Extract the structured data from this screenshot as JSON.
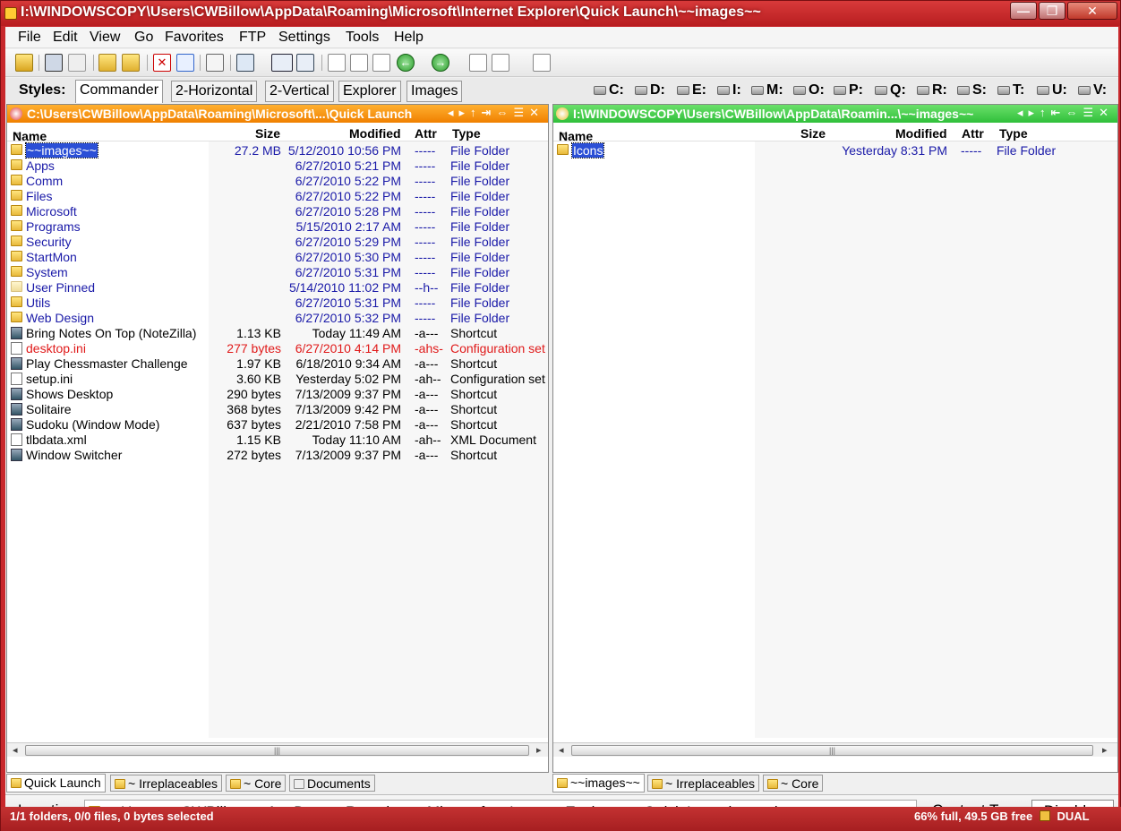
{
  "window": {
    "title": "I:\\WINDOWSCOPY\\Users\\CWBillow\\AppData\\Roaming\\Microsoft\\Internet Explorer\\Quick Launch\\~~images~~",
    "minimize": "—",
    "maximize": "❐",
    "close": "✕"
  },
  "menu": [
    "File",
    "Edit",
    "View",
    "Go",
    "Favorites",
    "FTP",
    "Settings",
    "Tools",
    "Help"
  ],
  "styles": {
    "label": "Styles:",
    "tabs": [
      "Commander",
      "2-Horizontal",
      "2-Vertical",
      "Explorer",
      "Images"
    ]
  },
  "drives": [
    "C:",
    "D:",
    "E:",
    "I:",
    "M:",
    "O:",
    "P:",
    "Q:",
    "R:",
    "S:",
    "T:",
    "U:",
    "V:"
  ],
  "left_pane": {
    "path": "C:\\Users\\CWBillow\\AppData\\Roaming\\Microsoft\\...\\Quick Launch",
    "columns": {
      "name": "Name",
      "size": "Size",
      "modified": "Modified",
      "attr": "Attr",
      "type": "Type"
    },
    "rows": [
      {
        "name": "~~images~~",
        "size": "27.2 MB",
        "modified": "5/12/2010 10:56 PM",
        "attr": "-----",
        "type": "File Folder",
        "kind": "folder",
        "color": "blue",
        "selected": true
      },
      {
        "name": "Apps",
        "size": "",
        "modified": "6/27/2010 5:21 PM",
        "attr": "-----",
        "type": "File Folder",
        "kind": "folder",
        "color": "blue"
      },
      {
        "name": "Comm",
        "size": "",
        "modified": "6/27/2010 5:22 PM",
        "attr": "-----",
        "type": "File Folder",
        "kind": "folder",
        "color": "blue"
      },
      {
        "name": "Files",
        "size": "",
        "modified": "6/27/2010 5:22 PM",
        "attr": "-----",
        "type": "File Folder",
        "kind": "folder",
        "color": "blue"
      },
      {
        "name": "Microsoft",
        "size": "",
        "modified": "6/27/2010 5:28 PM",
        "attr": "-----",
        "type": "File Folder",
        "kind": "folder",
        "color": "blue"
      },
      {
        "name": "Programs",
        "size": "",
        "modified": "5/15/2010 2:17 AM",
        "attr": "-----",
        "type": "File Folder",
        "kind": "folder",
        "color": "blue"
      },
      {
        "name": "Security",
        "size": "",
        "modified": "6/27/2010 5:29 PM",
        "attr": "-----",
        "type": "File Folder",
        "kind": "folder",
        "color": "blue"
      },
      {
        "name": "StartMon",
        "size": "",
        "modified": "6/27/2010 5:30 PM",
        "attr": "-----",
        "type": "File Folder",
        "kind": "folder",
        "color": "blue"
      },
      {
        "name": "System",
        "size": "",
        "modified": "6/27/2010 5:31 PM",
        "attr": "-----",
        "type": "File Folder",
        "kind": "folder",
        "color": "blue"
      },
      {
        "name": "User Pinned",
        "size": "",
        "modified": "5/14/2010 11:02 PM",
        "attr": "--h--",
        "type": "File Folder",
        "kind": "folder-pale",
        "color": "blue"
      },
      {
        "name": "Utils",
        "size": "",
        "modified": "6/27/2010 5:31 PM",
        "attr": "-----",
        "type": "File Folder",
        "kind": "folder",
        "color": "blue"
      },
      {
        "name": "Web Design",
        "size": "",
        "modified": "6/27/2010 5:32 PM",
        "attr": "-----",
        "type": "File Folder",
        "kind": "folder",
        "color": "blue"
      },
      {
        "name": "Bring Notes On Top (NoteZilla)",
        "size": "1.13 KB",
        "modified": "Today 11:49 AM",
        "attr": "-a---",
        "type": "Shortcut",
        "kind": "shortcut",
        "color": "black"
      },
      {
        "name": "desktop.ini",
        "size": "277 bytes",
        "modified": "6/27/2010 4:14 PM",
        "attr": "-ahs-",
        "type": "Configuration set",
        "kind": "file",
        "color": "red"
      },
      {
        "name": "Play Chessmaster Challenge",
        "size": "1.97 KB",
        "modified": "6/18/2010 9:34 AM",
        "attr": "-a---",
        "type": "Shortcut",
        "kind": "shortcut",
        "color": "black"
      },
      {
        "name": "setup.ini",
        "size": "3.60 KB",
        "modified": "Yesterday 5:02 PM",
        "attr": "-ah--",
        "type": "Configuration set",
        "kind": "file",
        "color": "black"
      },
      {
        "name": "Shows Desktop",
        "size": "290 bytes",
        "modified": "7/13/2009 9:37 PM",
        "attr": "-a---",
        "type": "Shortcut",
        "kind": "shortcut",
        "color": "black"
      },
      {
        "name": "Solitaire",
        "size": "368 bytes",
        "modified": "7/13/2009 9:42 PM",
        "attr": "-a---",
        "type": "Shortcut",
        "kind": "shortcut",
        "color": "black"
      },
      {
        "name": "Sudoku (Window Mode)",
        "size": "637 bytes",
        "modified": "2/21/2010 7:58 PM",
        "attr": "-a---",
        "type": "Shortcut",
        "kind": "shortcut",
        "color": "black"
      },
      {
        "name": "tlbdata.xml",
        "size": "1.15 KB",
        "modified": "Today 11:10 AM",
        "attr": "-ah--",
        "type": "XML Document",
        "kind": "file",
        "color": "black"
      },
      {
        "name": "Window Switcher",
        "size": "272 bytes",
        "modified": "7/13/2009 9:37 PM",
        "attr": "-a---",
        "type": "Shortcut",
        "kind": "shortcut",
        "color": "black"
      }
    ],
    "tabs": [
      "Quick Launch",
      "~ Irreplaceables",
      "~ Core",
      "Documents"
    ]
  },
  "right_pane": {
    "path": "I:\\WINDOWSCOPY\\Users\\CWBillow\\AppData\\Roamin...\\~~images~~",
    "columns": {
      "name": "Name",
      "size": "Size",
      "modified": "Modified",
      "attr": "Attr",
      "type": "Type"
    },
    "rows": [
      {
        "name": "Icons",
        "size": "",
        "modified": "Yesterday 8:31 PM",
        "attr": "-----",
        "type": "File Folder",
        "kind": "folder",
        "color": "blue",
        "selected": true
      }
    ],
    "tabs": [
      "~~images~~",
      "~ Irreplaceables",
      "~ Core"
    ]
  },
  "location": {
    "label": "Location",
    "crumbs": [
      "«",
      "Users",
      "CWBillow",
      "AppData",
      "Roaming",
      "Microsoft",
      "Internet Explorer",
      "Quick Launch",
      "~~images~~"
    ],
    "content_type_label": "Content Type",
    "content_type_value": "<Disable"
  },
  "status": {
    "left": "1/1 folders, 0/0 files, 0 bytes selected",
    "right": "66% full, 49.5 GB free",
    "mode": "DUAL"
  }
}
